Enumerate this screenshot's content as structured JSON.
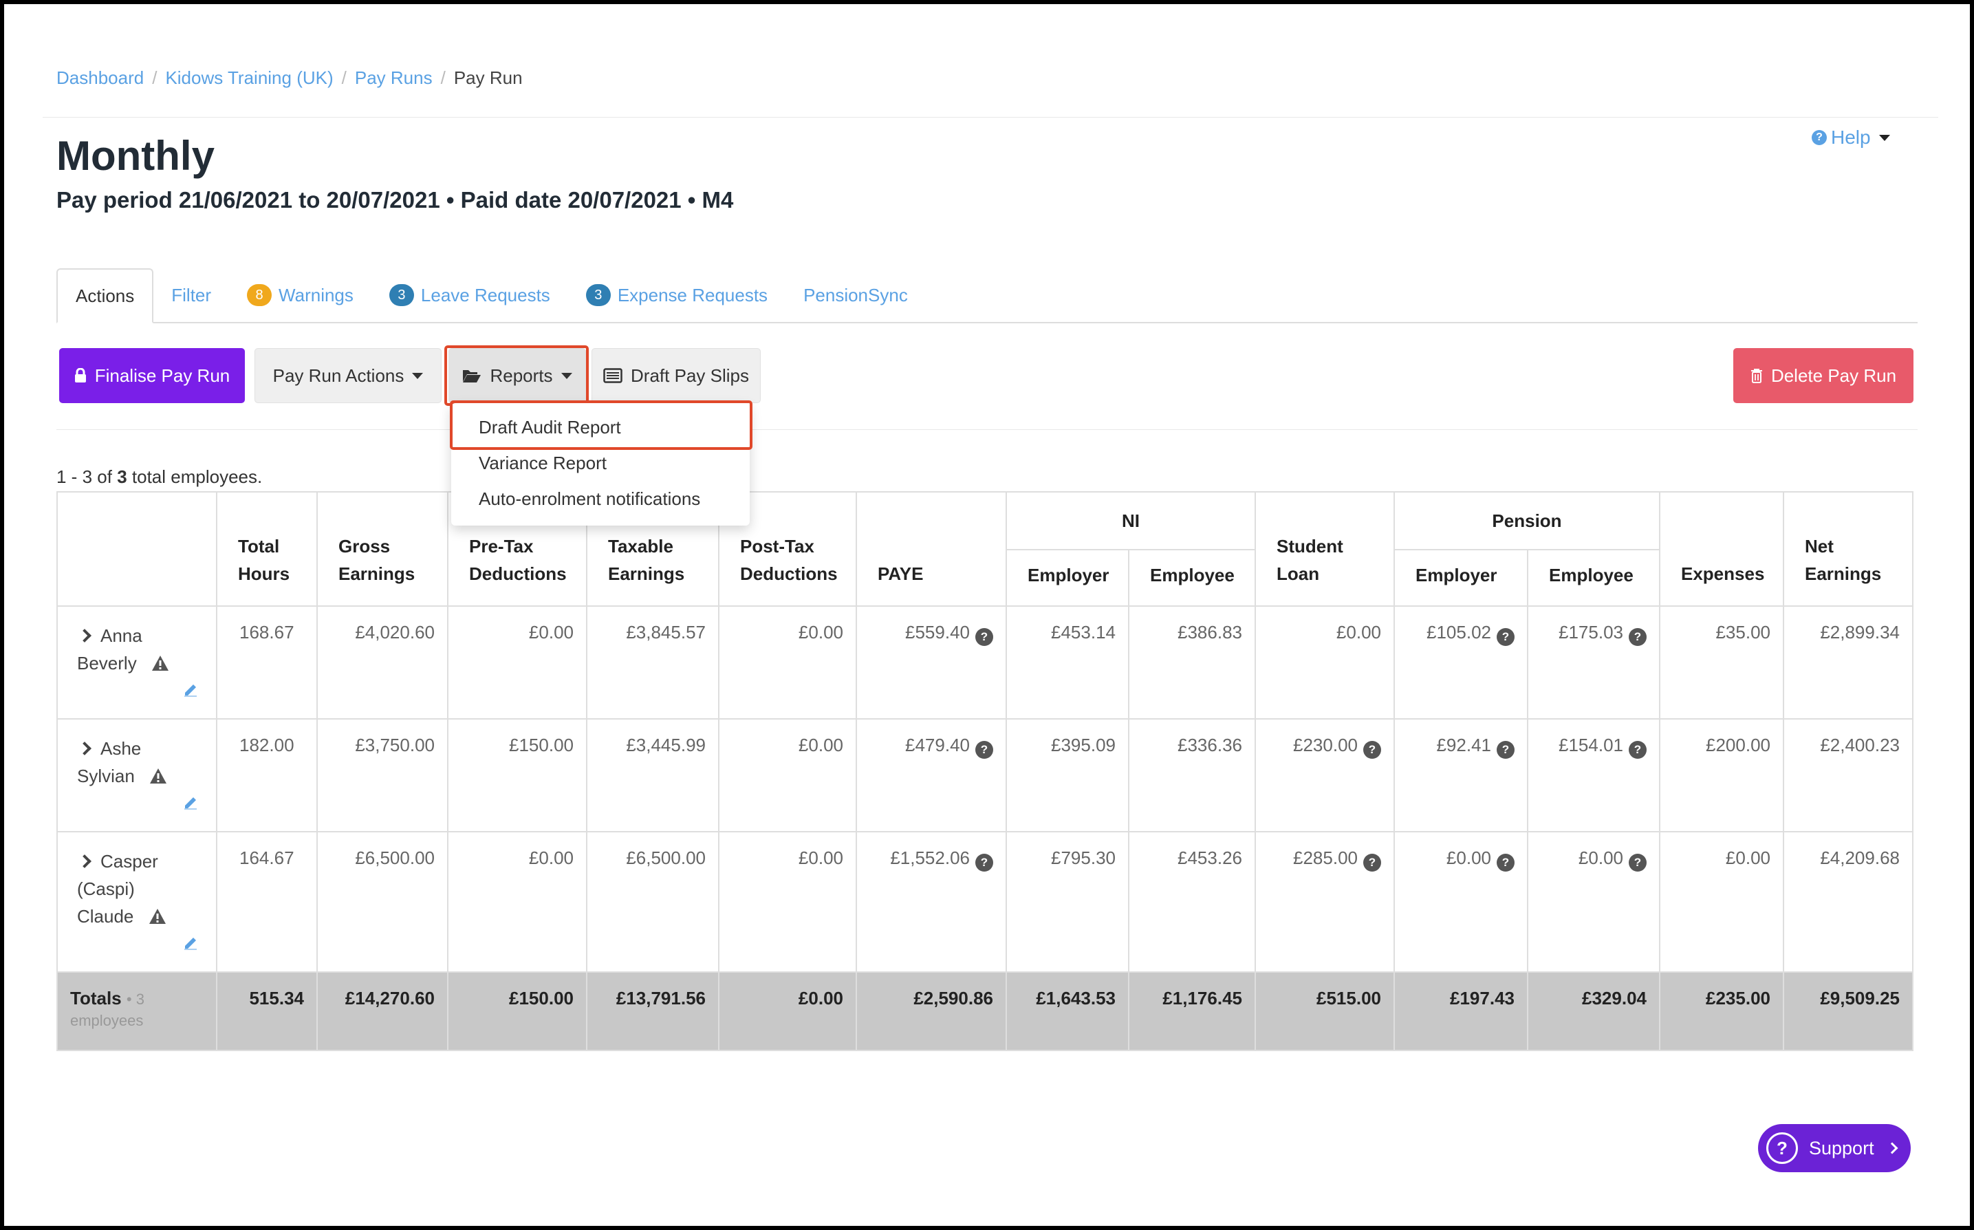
{
  "breadcrumb": {
    "items": [
      "Dashboard",
      "Kidows Training (UK)",
      "Pay Runs"
    ],
    "current": "Pay Run",
    "separator": "/"
  },
  "header": {
    "title": "Monthly",
    "subtitle": "Pay period 21/06/2021 to 20/07/2021 • Paid date 20/07/2021 • M4",
    "help_label": "Help",
    "help_icon": "?"
  },
  "tabs": [
    {
      "label": "Actions",
      "active": true
    },
    {
      "label": "Filter"
    },
    {
      "label": "Warnings",
      "badge": "8",
      "badge_color": "#f0a81c"
    },
    {
      "label": "Leave Requests",
      "badge": "3",
      "badge_color": "#2f7fb3"
    },
    {
      "label": "Expense Requests",
      "badge": "3",
      "badge_color": "#2f7fb3"
    },
    {
      "label": "PensionSync"
    }
  ],
  "toolbar": {
    "finalise_label": "Finalise Pay Run",
    "pay_run_actions_label": "Pay Run Actions",
    "reports_label": "Reports",
    "draft_pay_slips_label": "Draft Pay Slips",
    "delete_label": "Delete Pay Run"
  },
  "reports_menu": {
    "items": [
      "Draft Audit Report",
      "Variance Report",
      "Auto-enrolment notifications"
    ],
    "highlighted": "Draft Audit Report"
  },
  "count": {
    "range": "1 - 3",
    "of": "of",
    "total": "3",
    "suffix": "total employees."
  },
  "table": {
    "headers": {
      "total_hours": [
        "Total",
        "Hours"
      ],
      "gross": [
        "Gross",
        "Earnings"
      ],
      "pretax": [
        "Pre-Tax",
        "Deductions"
      ],
      "taxable": [
        "Taxable",
        "Earnings"
      ],
      "posttax": [
        "Post-Tax",
        "Deductions"
      ],
      "paye": "PAYE",
      "ni_group": "NI",
      "ni_employer": "Employer",
      "ni_employee": "Employee",
      "student_loan": [
        "Student",
        "Loan"
      ],
      "pension_group": "Pension",
      "pension_employer": "Employer",
      "pension_employee": "Employee",
      "expenses": "Expenses",
      "net": [
        "Net",
        "Earnings"
      ]
    },
    "rows": [
      {
        "name_lines": [
          "Anna",
          "Beverly"
        ],
        "hours": "168.67",
        "gross": "£4,020.60",
        "pretax": "£0.00",
        "taxable": "£3,845.57",
        "posttax": "£0.00",
        "paye": "£559.40",
        "ni_employer": "£453.14",
        "ni_employee": "£386.83",
        "student_loan": "£0.00",
        "pension_employer": "£105.02",
        "pension_employee": "£175.03",
        "expenses": "£35.00",
        "net": "£2,899.34"
      },
      {
        "name_lines": [
          "Ashe",
          "Sylvian"
        ],
        "hours": "182.00",
        "gross": "£3,750.00",
        "pretax": "£150.00",
        "taxable": "£3,445.99",
        "posttax": "£0.00",
        "paye": "£479.40",
        "ni_employer": "£395.09",
        "ni_employee": "£336.36",
        "student_loan": "£230.00",
        "pension_employer": "£92.41",
        "pension_employee": "£154.01",
        "expenses": "£200.00",
        "net": "£2,400.23"
      },
      {
        "name_lines": [
          "Casper",
          "(Caspi)",
          "Claude"
        ],
        "hours": "164.67",
        "gross": "£6,500.00",
        "pretax": "£0.00",
        "taxable": "£6,500.00",
        "posttax": "£0.00",
        "paye": "£1,552.06",
        "ni_employer": "£795.30",
        "ni_employee": "£453.26",
        "student_loan": "£285.00",
        "pension_employer": "£0.00",
        "pension_employee": "£0.00",
        "expenses": "£0.00",
        "net": "£4,209.68"
      }
    ],
    "totals": {
      "label": "Totals",
      "sub": "• 3 employees",
      "hours": "515.34",
      "gross": "£14,270.60",
      "pretax": "£150.00",
      "taxable": "£13,791.56",
      "posttax": "£0.00",
      "paye": "£2,590.86",
      "ni_employer": "£1,643.53",
      "ni_employee": "£1,176.45",
      "student_loan": "£515.00",
      "pension_employer": "£197.43",
      "pension_employee": "£329.04",
      "expenses": "£235.00",
      "net": "£9,509.25"
    }
  },
  "support": {
    "label": "Support",
    "icon": "?"
  },
  "colors": {
    "link": "#5aa1e3",
    "primary": "#7a1fe8",
    "danger": "#e85a6a",
    "highlight": "#e0482a",
    "support": "#6b22d6"
  },
  "icons": [
    "lock-icon",
    "caret-down-icon",
    "folder-open-icon",
    "list-icon",
    "trash-icon",
    "chevron-right-icon",
    "warning-icon",
    "pencil-icon",
    "question-icon"
  ]
}
